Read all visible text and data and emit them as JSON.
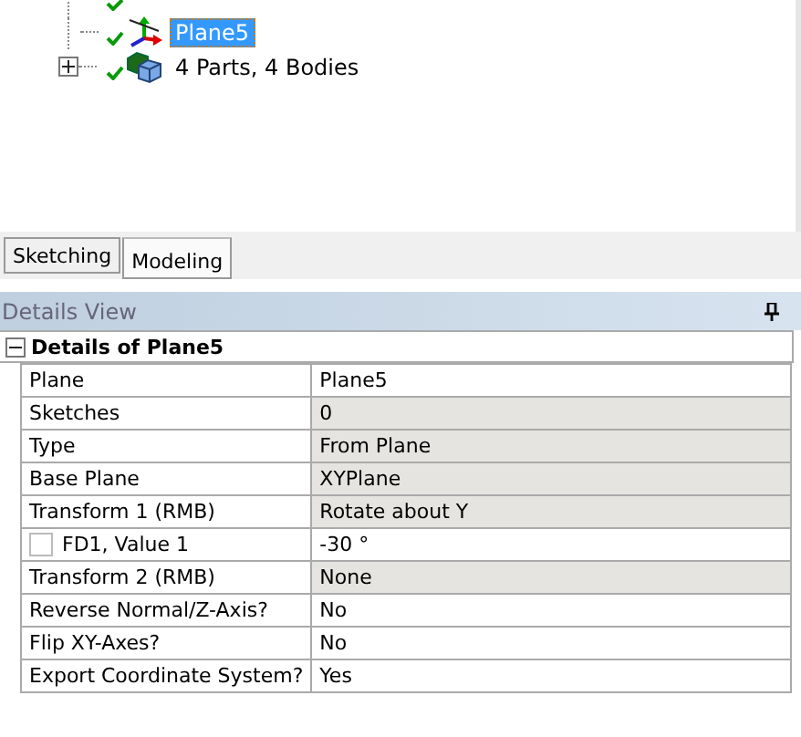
{
  "tree": {
    "items": [
      {
        "label": "Plane5",
        "selected": true,
        "kind": "plane",
        "expandable": false
      },
      {
        "label": "4 Parts, 4 Bodies",
        "selected": false,
        "kind": "bodies",
        "expandable": true,
        "expanded": false
      }
    ]
  },
  "tabs": [
    {
      "label": "Sketching",
      "selected": false
    },
    {
      "label": "Modeling",
      "selected": true
    }
  ],
  "details": {
    "title": "Details View",
    "group": {
      "title": "Details of Plane5",
      "expanded": true
    },
    "rows": [
      {
        "name": "Plane",
        "value": "Plane5",
        "readonly": false
      },
      {
        "name": "Sketches",
        "value": "0",
        "readonly": true
      },
      {
        "name": "Type",
        "value": "From Plane",
        "readonly": true
      },
      {
        "name": "Base Plane",
        "value": "XYPlane",
        "readonly": true
      },
      {
        "name": "Transform 1 (RMB)",
        "value": "Rotate about Y",
        "readonly": true
      },
      {
        "name": "FD1, Value 1",
        "value": "-30 °",
        "readonly": false,
        "kind": "parameter",
        "checked": false
      },
      {
        "name": "Transform 2 (RMB)",
        "value": "None",
        "readonly": true
      },
      {
        "name": "Reverse Normal/Z-Axis?",
        "value": "No",
        "readonly": false
      },
      {
        "name": "Flip XY-Axes?",
        "value": "No",
        "readonly": false
      },
      {
        "name": "Export Coordinate System?",
        "value": "Yes",
        "readonly": false
      }
    ]
  }
}
